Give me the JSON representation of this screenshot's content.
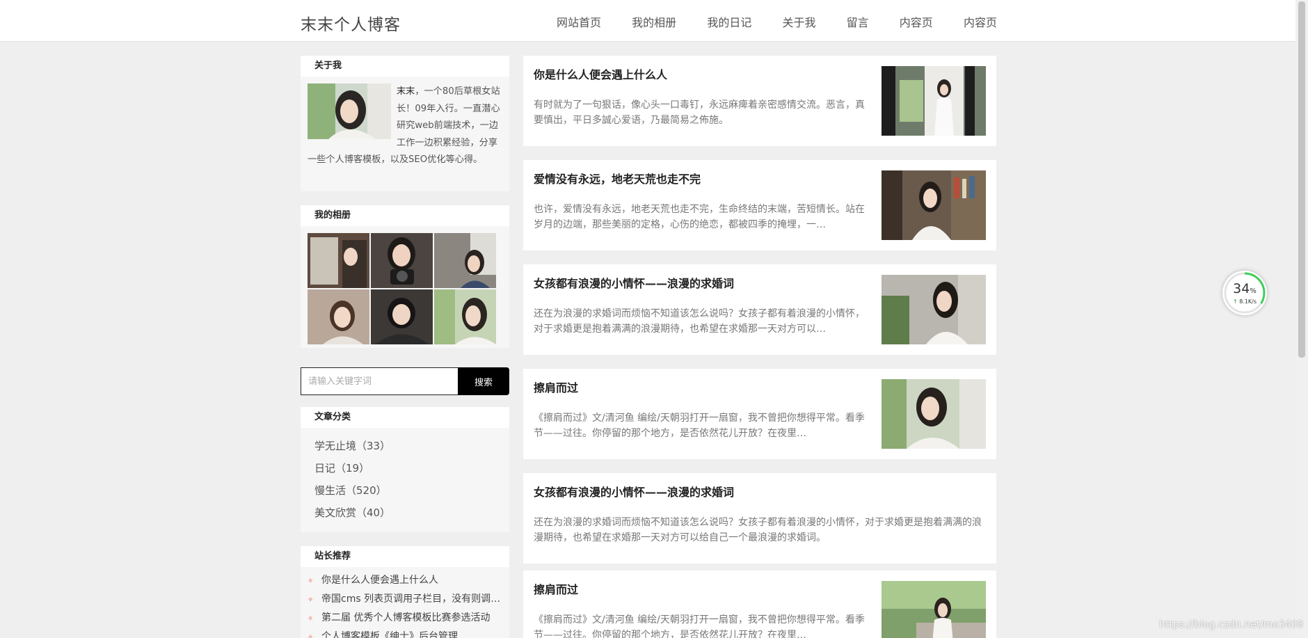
{
  "site": {
    "logo": "末末个人博客",
    "nav": [
      "网站首页",
      "我的相册",
      "我的日记",
      "关于我",
      "留言",
      "内容页",
      "内容页"
    ]
  },
  "about": {
    "title": "关于我",
    "name": "末末",
    "text": "，一个80后草根女站长！09年入行。一直潜心研究web前端技术，一边工作一边积累经验，分享一些个人博客模板，以及SEO优化等心得。"
  },
  "album": {
    "title": "我的相册"
  },
  "search": {
    "placeholder": "请输入关键字词",
    "button": "搜索"
  },
  "categories": {
    "title": "文章分类",
    "items": [
      "学无止境（33）",
      "日记（19）",
      "慢生活（520）",
      "美文欣赏（40）"
    ]
  },
  "recommend": {
    "title": "站长推荐",
    "items": [
      "你是什么人便会遇上什么人",
      "帝国cms 列表页调用子栏目，没有则调用同级栏目",
      "第二届 优秀个人博客模板比赛参选活动",
      "个人博客模板《绅士》后台管理"
    ]
  },
  "posts": [
    {
      "title": "你是什么人便会遇上什么人",
      "summary": "有时就为了一句狠话，像心头一口毒钉，永远麻痺着亲密感情交流。恶言，真要慎出，平日多誠心爱语，乃最简易之佈施。",
      "thumb": true
    },
    {
      "title": "爱情没有永远，地老天荒也走不完",
      "summary": "也许，爱情没有永远，地老天荒也走不完，生命终结的末端，苦短情长。站在岁月的边端，那些美丽的定格，心伤的绝恋，都被四季的掩埋，一…",
      "thumb": true
    },
    {
      "title": "女孩都有浪漫的小情怀——浪漫的求婚词",
      "summary": "还在为浪漫的求婚词而烦恼不知道该怎么说吗？女孩子都有着浪漫的小情怀，对于求婚更是抱着满满的浪漫期待，也希望在求婚那一天对方可以…",
      "thumb": true
    },
    {
      "title": "擦肩而过",
      "summary": "《擦肩而过》文/清河鱼 编绘/天朝羽打开一扇窗，我不曾把你想得平常。看季节——过往。你停留的那个地方，是否依然花儿开放？在夜里…",
      "thumb": true
    },
    {
      "title": "女孩都有浪漫的小情怀——浪漫的求婚词",
      "summary": "还在为浪漫的求婚词而烦恼不知道该怎么说吗？女孩子都有着浪漫的小情怀，对于求婚更是抱着满满的浪漫期待，也希望在求婚那一天对方可以给自己一个最浪漫的求婚词。",
      "thumb": false
    },
    {
      "title": "擦肩而过",
      "summary": "《擦肩而过》文/清河鱼 编绘/天朝羽打开一扇窗，我不曾把你想得平常。看季节——过往。你停留的那个地方，是否依然花儿开放？在夜里…",
      "thumb": true
    }
  ],
  "widget": {
    "percent": "34",
    "percent_unit": "%",
    "speed": "8.1K/s",
    "speed_arrow": "↑",
    "progress": 0.34
  },
  "watermark": "https://blog.csdn.net/mo3408",
  "colors": {
    "accent": "#e65a3c",
    "widget_ring": "#3fce5a",
    "search_button": "#000000"
  }
}
